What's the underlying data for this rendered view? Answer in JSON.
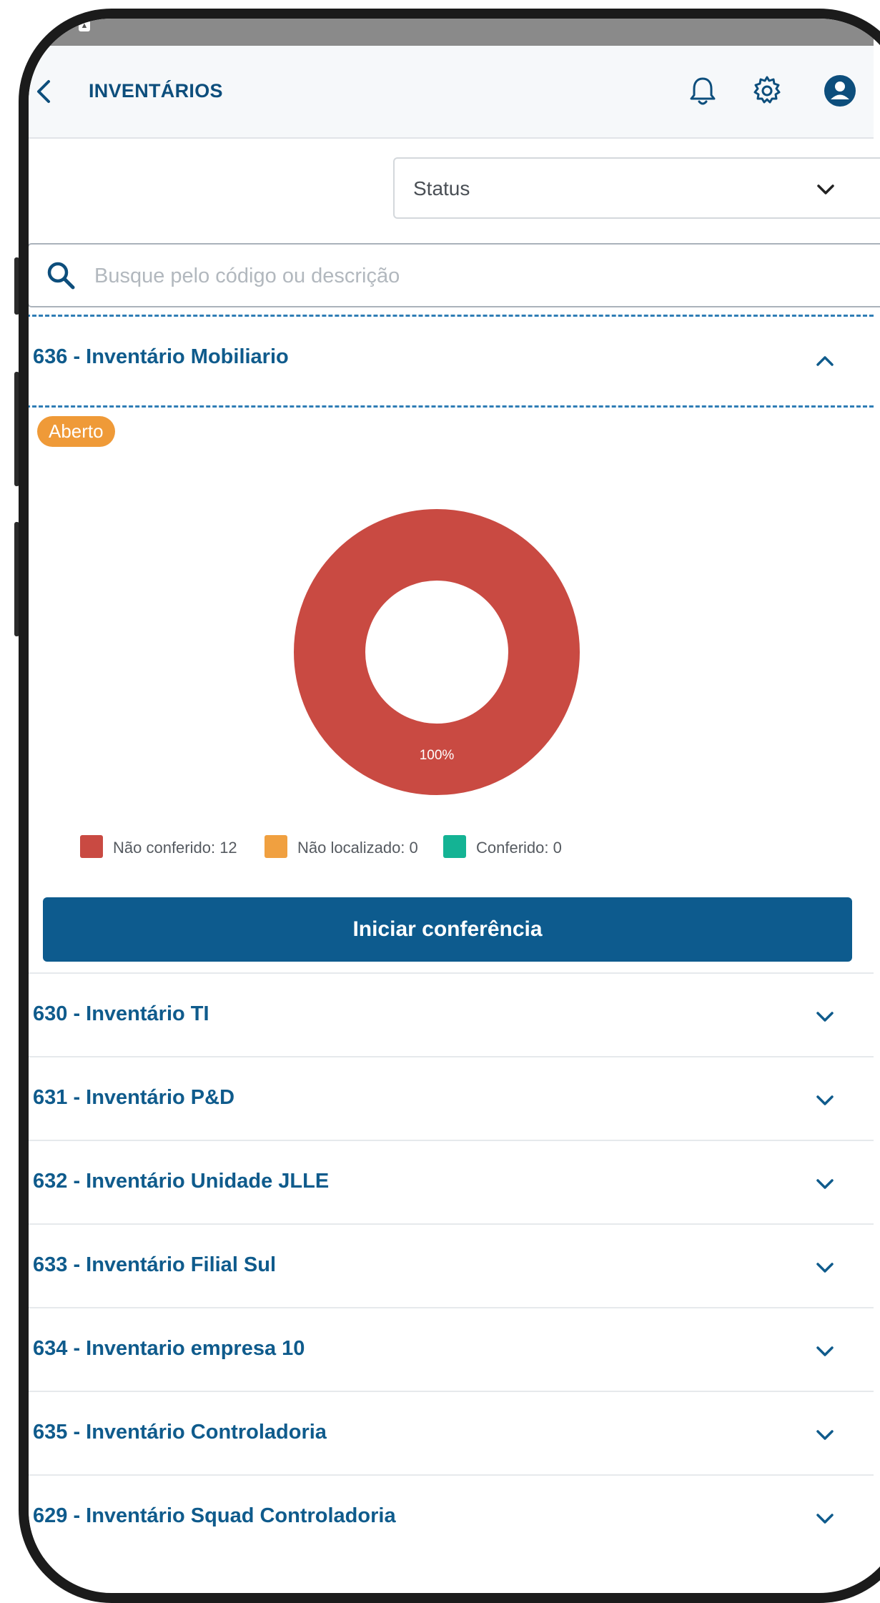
{
  "header": {
    "title": "INVENTÁRIOS"
  },
  "filters": {
    "status_label": "Status",
    "search_placeholder": "Busque pelo código ou descrição"
  },
  "expanded_inventory": {
    "title": "636 - Inventário Mobiliario",
    "badge": "Aberto",
    "badge_color": "#ef9a38",
    "action_label": "Iniciar conferência"
  },
  "chart_data": {
    "type": "pie",
    "style": "donut",
    "categories": [
      "Não conferido",
      "Não localizado",
      "Conferido"
    ],
    "values": [
      12,
      0,
      0
    ],
    "colors": [
      "#c94a42",
      "#f0a040",
      "#14b394"
    ],
    "slice_labels": [
      "100%"
    ],
    "legend": [
      "Não conferido: 12",
      "Não localizado: 0",
      "Conferido: 0"
    ],
    "legend_position": "bottom"
  },
  "inventories": [
    {
      "title": "630 - Inventário TI"
    },
    {
      "title": "631 - Inventário P&D"
    },
    {
      "title": "632 - Inventário Unidade JLLE"
    },
    {
      "title": "633 - Inventário Filial Sul"
    },
    {
      "title": "634 - Inventario empresa 10"
    },
    {
      "title": "635 - Inventário Controladoria"
    },
    {
      "title": "629 - Inventário Squad Controladoria"
    }
  ],
  "colors": {
    "primary": "#0d5b8e",
    "accent_text": "#0f5b8c",
    "divider_dashed": "#2f7db5"
  }
}
